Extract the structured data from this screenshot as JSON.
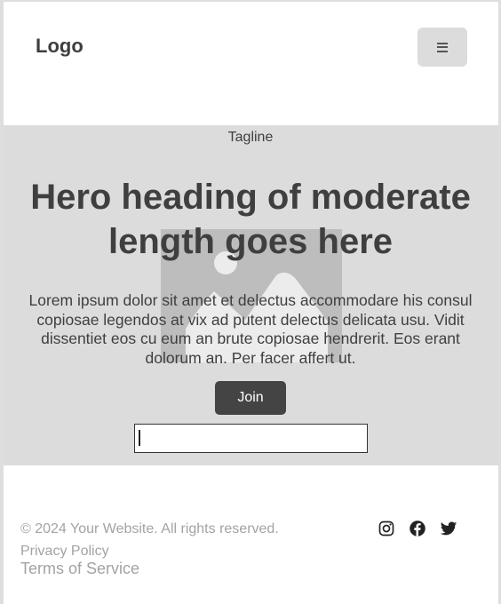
{
  "header": {
    "logo": "Logo",
    "menu_icon": "hamburger-icon"
  },
  "hero": {
    "tagline": "Tagline",
    "title": "Hero heading of moderate length goes here",
    "text": "Lorem ipsum dolor sit amet et delectus accommodare his consul copiosae legendos at vix ad putent delectus delicata usu. Vidit dissentiet eos cu eum an brute copiosae hendrerit. Eos erant dolorum an. Per facer affert ut.",
    "image_icon": "image-placeholder-icon",
    "join_label": "Join",
    "input_value": "",
    "input_placeholder": ""
  },
  "footer": {
    "copyright": "© 2024 Your Website. All rights reserved.",
    "links": [
      "Privacy Policy",
      "Terms of Service"
    ],
    "social_icons": [
      "instagram-icon",
      "facebook-icon",
      "twitter-icon"
    ]
  },
  "colors": {
    "background": "#dedede",
    "hero_bg": "#dcdcdc",
    "button_bg": "#444444",
    "text_dark": "#3f3f3f",
    "text_muted": "#a3a3a3"
  }
}
